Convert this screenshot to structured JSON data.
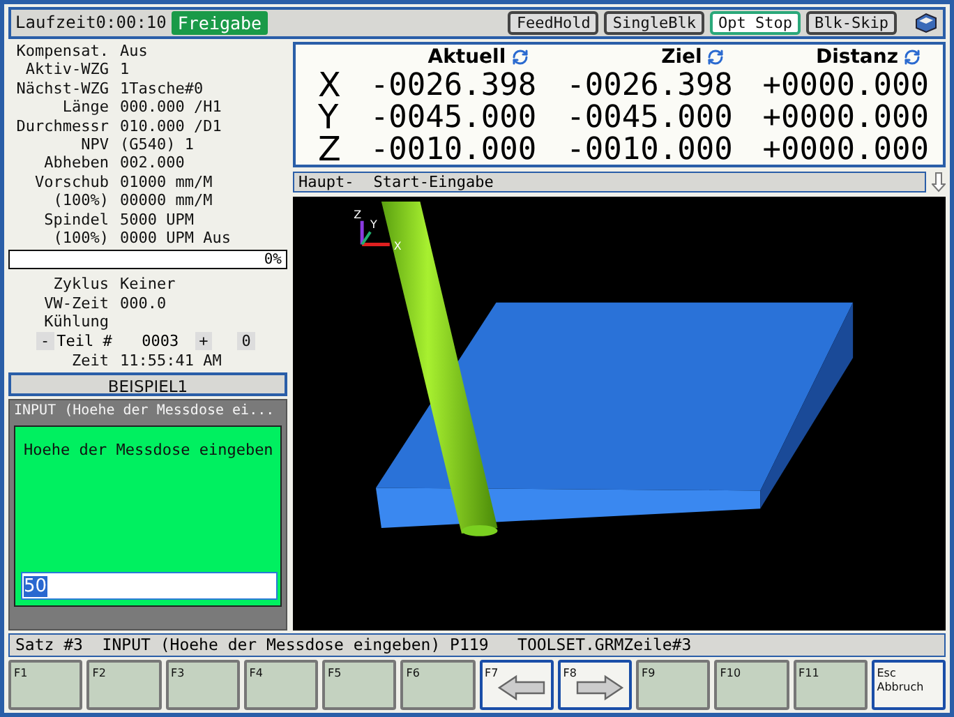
{
  "top_bar": {
    "runtime": "Laufzeit0:00:10",
    "release": "Freigabe",
    "toggles": [
      {
        "label": "FeedHold",
        "active": false
      },
      {
        "label": "SingleBlk",
        "active": false
      },
      {
        "label": "Opt Stop",
        "active": true
      },
      {
        "label": "Blk-Skip",
        "active": false
      }
    ]
  },
  "info": {
    "rows": [
      {
        "label": "Kompensat.",
        "value": "Aus"
      },
      {
        "label": "Aktiv-WZG",
        "value": "1"
      },
      {
        "label": "Nächst-WZG",
        "value": "1Tasche#0"
      },
      {
        "label": "Länge",
        "value": "000.000 /H1"
      },
      {
        "label": "Durchmessr",
        "value": "010.000 /D1"
      },
      {
        "label": "NPV",
        "value": "(G540) 1"
      },
      {
        "label": "Abheben",
        "value": "002.000"
      },
      {
        "label": "Vorschub",
        "value": "01000 mm/M"
      },
      {
        "label": "(100%)",
        "value": "00000 mm/M"
      },
      {
        "label": "Spindel",
        "value": "5000 UPM"
      },
      {
        "label": "(100%)",
        "value": "0000 UPM Aus"
      }
    ],
    "progress": {
      "level": 0,
      "reading": "0%"
    },
    "rows2": [
      {
        "label": "Zyklus",
        "value": "Keiner"
      },
      {
        "label": "VW-Zeit",
        "value": "000.0"
      },
      {
        "label": "Kühlung"
      }
    ],
    "part": {
      "minus": "-",
      "label": "Teil #",
      "value": "0003",
      "plus": "+",
      "reset": "0"
    },
    "time": {
      "label": "Zeit",
      "value": "11:55:41 AM"
    },
    "program_name": "BEISPIEL1"
  },
  "input_dialog": {
    "title": "INPUT (Hoehe der Messdose ei...",
    "prompt": "Hoehe der Messdose eingeben",
    "value": "50",
    "value_selected": true
  },
  "dro": {
    "columns": [
      "Aktuell",
      "Ziel",
      "Distanz"
    ],
    "axes": [
      {
        "axis": "X",
        "values": [
          "-0026.398",
          "-0026.398",
          "+0000.000"
        ]
      },
      {
        "axis": "Y",
        "values": [
          "-0045.000",
          "-0045.000",
          "+0000.000"
        ]
      },
      {
        "axis": "Z",
        "values": [
          "-0010.000",
          "-0010.000",
          "+0000.000"
        ]
      }
    ]
  },
  "program_bar": {
    "items": [
      "Haupt-",
      "Start-Eingabe"
    ]
  },
  "viewport": {
    "axes": [
      "Z",
      "Y",
      "X"
    ]
  },
  "status_line": "Satz #3  INPUT (Hoehe der Messdose eingeben) P119   TOOLSET.GRMZeile#3",
  "function_keys": [
    {
      "label": "F1",
      "kind": "plain",
      "enabled": false
    },
    {
      "label": "F2",
      "kind": "plain",
      "enabled": false
    },
    {
      "label": "F3",
      "kind": "plain",
      "enabled": false
    },
    {
      "label": "F4",
      "kind": "plain",
      "enabled": false
    },
    {
      "label": "F5",
      "kind": "plain",
      "enabled": false
    },
    {
      "label": "F6",
      "kind": "plain",
      "enabled": false
    },
    {
      "label": "F7",
      "kind": "arrow-left",
      "enabled": true
    },
    {
      "label": "F8",
      "kind": "arrow-right",
      "enabled": true
    },
    {
      "label": "F9",
      "kind": "plain",
      "enabled": false
    },
    {
      "label": "F10",
      "kind": "plain",
      "enabled": false
    },
    {
      "label": "F11",
      "kind": "plain",
      "enabled": false
    },
    {
      "label": "Esc\nAbbruch",
      "kind": "plain",
      "enabled": true
    }
  ]
}
